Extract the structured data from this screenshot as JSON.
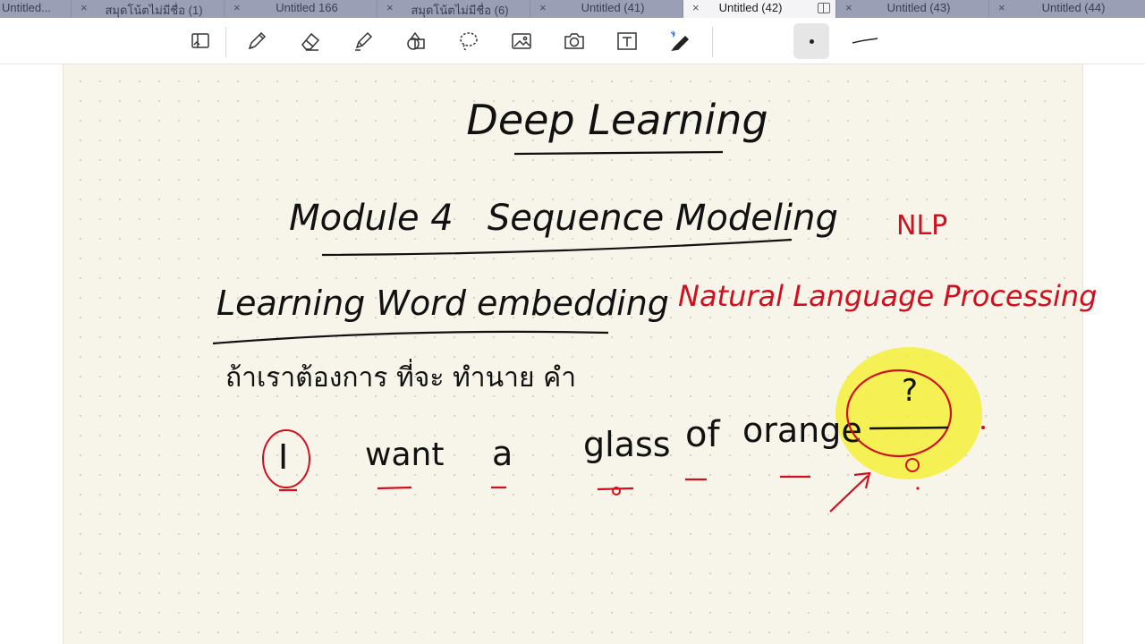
{
  "tabs": [
    {
      "label": "Untitled...",
      "active": false
    },
    {
      "label": "สมุดโน้ตไม่มีชื่อ (1)",
      "active": false
    },
    {
      "label": "Untitled 166",
      "active": false
    },
    {
      "label": "สมุดโน้ตไม่มีชื่อ (6)",
      "active": false
    },
    {
      "label": "Untitled (41)",
      "active": false
    },
    {
      "label": "Untitled (42)",
      "active": true
    },
    {
      "label": "Untitled (43)",
      "active": false
    },
    {
      "label": "Untitled (44)",
      "active": false
    }
  ],
  "note": {
    "title": "Deep Learning",
    "module": "Module 4   Sequence Modeling",
    "nlp": "NLP",
    "topic": "Learning Word embedding",
    "nlp_full": "Natural Language Processing",
    "thai_line": "ถ้าเราต้องการ ที่จะ ทำนาย คำ",
    "sentence_words": [
      "I",
      "want",
      "a",
      "glass",
      "of",
      "orange"
    ],
    "blank_mark": "?"
  },
  "colors": {
    "ink_black": "#111111",
    "ink_red": "#d0101f",
    "highlight_yellow": "#f4f03a",
    "tabbar": "#9b9fb6",
    "paper": "#f7f4e9"
  }
}
